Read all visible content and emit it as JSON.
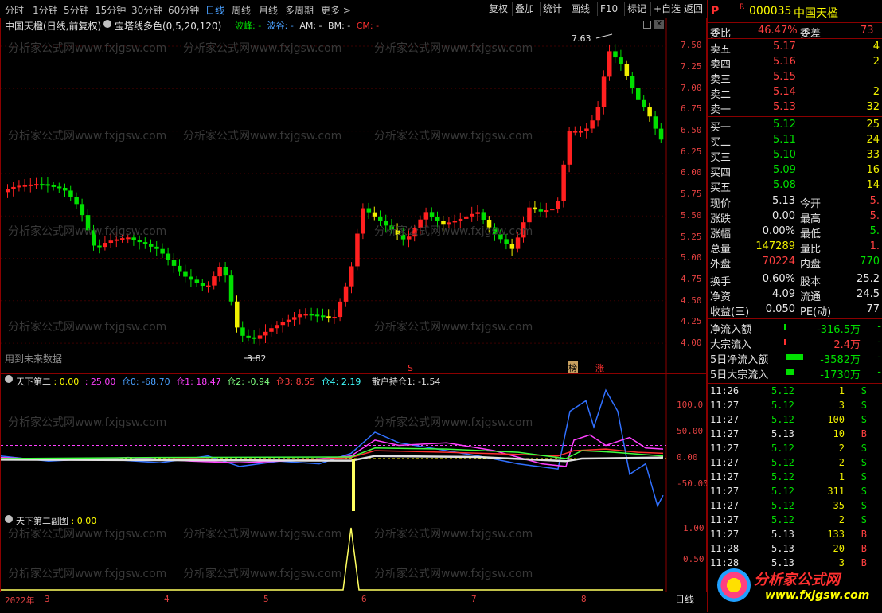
{
  "toolbar": {
    "periods": [
      "分时",
      "1分钟",
      "5分钟",
      "15分钟",
      "30分钟",
      "60分钟",
      "日线",
      "周线",
      "月线",
      "多周期",
      "更多 >"
    ],
    "active_period": "日线",
    "buttons": [
      "复权",
      "叠加",
      "统计",
      "画线",
      "F10",
      "标记",
      "+自选",
      "返回"
    ]
  },
  "main_chart": {
    "title": "中国天楹(日线,前复权)",
    "indicator": "宝塔线多色(0,5,20,120)",
    "legend": [
      "波峰: -",
      "波谷: -",
      "AM: -",
      "BM: -",
      "CM: -"
    ],
    "max_label": "7.63",
    "min_label": "3.82",
    "note": "用到未来数据",
    "markers": [
      "S",
      "榜",
      "涨"
    ],
    "y_ticks": [
      "7.50",
      "7.25",
      "7.00",
      "6.75",
      "6.50",
      "6.25",
      "6.00",
      "5.75",
      "5.50",
      "5.25",
      "5.00",
      "4.75",
      "4.50",
      "4.25",
      "4.00"
    ]
  },
  "sub1": {
    "title": "天下第二",
    "values": [
      ": 0.00",
      ": 25.00",
      "仓0: -68.70",
      "仓1: 18.47",
      "仓2: -0.94",
      "仓3: 8.55",
      "仓4: 2.19",
      "散户持仓1: -1.54"
    ],
    "y_ticks": [
      "100.0",
      "50.00",
      "0.00",
      "-50.00"
    ]
  },
  "sub2": {
    "title": "天下第二副图",
    "value": ": 0.00",
    "y_ticks": [
      "1.00",
      "0.50"
    ]
  },
  "x_axis": {
    "year": "2022年",
    "months": [
      "3",
      "4",
      "5",
      "6",
      "7",
      "8"
    ],
    "period_label": "日线"
  },
  "watermark": "分析家公式网www.fxjgsw.com",
  "panel": {
    "p_badge": "P",
    "r_badge": "R",
    "code": "000035",
    "name": "中国天楹",
    "ratio_label": "委比",
    "ratio_value": "46.47%",
    "diff_label": "委差",
    "diff_value": "73",
    "asks": [
      {
        "label": "卖五",
        "price": "5.17",
        "vol": "4"
      },
      {
        "label": "卖四",
        "price": "5.16",
        "vol": "2"
      },
      {
        "label": "卖三",
        "price": "5.15",
        "vol": ""
      },
      {
        "label": "卖二",
        "price": "5.14",
        "vol": "2"
      },
      {
        "label": "卖一",
        "price": "5.13",
        "vol": "32"
      }
    ],
    "bids": [
      {
        "label": "买一",
        "price": "5.12",
        "vol": "25"
      },
      {
        "label": "买二",
        "price": "5.11",
        "vol": "24"
      },
      {
        "label": "买三",
        "price": "5.10",
        "vol": "33"
      },
      {
        "label": "买四",
        "price": "5.09",
        "vol": "16"
      },
      {
        "label": "买五",
        "price": "5.08",
        "vol": "14"
      }
    ],
    "quote": [
      {
        "l1": "现价",
        "v1": "5.13",
        "l2": "今开",
        "v2": "5."
      },
      {
        "l1": "涨跌",
        "v1": "0.00",
        "l2": "最高",
        "v2": "5."
      },
      {
        "l1": "涨幅",
        "v1": "0.00%",
        "l2": "最低",
        "v2": "5."
      },
      {
        "l1": "总量",
        "v1": "147289",
        "l2": "量比",
        "v2": "1."
      },
      {
        "l1": "外盘",
        "v1": "70224",
        "l2": "内盘",
        "v2": "770"
      }
    ],
    "fund": [
      {
        "l1": "换手",
        "v1": "0.60%",
        "l2": "股本",
        "v2": "25.2"
      },
      {
        "l1": "净资",
        "v1": "4.09",
        "l2": "流通",
        "v2": "24.5"
      },
      {
        "l1": "收益(三)",
        "v1": "0.050",
        "l2": "PE(动)",
        "v2": "77"
      }
    ],
    "flows": [
      {
        "label": "净流入额",
        "value": "-316.5万",
        "tail": "-"
      },
      {
        "label": "大宗流入",
        "value": "2.4万",
        "tail": "-"
      },
      {
        "label": "5日净流入额",
        "value": "-3582万",
        "tail": "-"
      },
      {
        "label": "5日大宗流入",
        "value": "-1730万",
        "tail": "-"
      }
    ],
    "ticks": [
      {
        "t": "11:26",
        "p": "5.12",
        "v": "1",
        "s": "S"
      },
      {
        "t": "11:27",
        "p": "5.12",
        "v": "3",
        "s": "S"
      },
      {
        "t": "11:27",
        "p": "5.12",
        "v": "100",
        "s": "S"
      },
      {
        "t": "11:27",
        "p": "5.13",
        "v": "10",
        "s": "B"
      },
      {
        "t": "11:27",
        "p": "5.12",
        "v": "2",
        "s": "S"
      },
      {
        "t": "11:27",
        "p": "5.12",
        "v": "2",
        "s": "S"
      },
      {
        "t": "11:27",
        "p": "5.12",
        "v": "1",
        "s": "S"
      },
      {
        "t": "11:27",
        "p": "5.12",
        "v": "311",
        "s": "S"
      },
      {
        "t": "11:27",
        "p": "5.12",
        "v": "35",
        "s": "S"
      },
      {
        "t": "11:27",
        "p": "5.12",
        "v": "2",
        "s": "S"
      },
      {
        "t": "11:27",
        "p": "5.13",
        "v": "133",
        "s": "B"
      },
      {
        "t": "11:28",
        "p": "5.13",
        "v": "20",
        "s": "B"
      },
      {
        "t": "11:28",
        "p": "5.13",
        "v": "3",
        "s": "B"
      }
    ],
    "logo_text": "分析家公式网",
    "logo_url": "www.fxjgsw.com"
  },
  "colors": {
    "up": "#ff3030",
    "down": "#00e000",
    "frame": "#8b0000",
    "active": "#4aa0ff"
  }
}
